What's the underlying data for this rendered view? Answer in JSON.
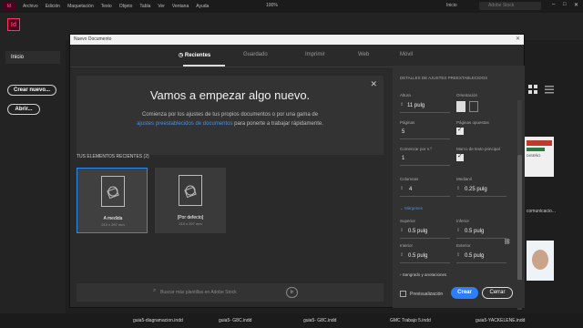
{
  "menubar": {
    "app_icon": "Id",
    "items": [
      "Archivo",
      "Edición",
      "Maquetación",
      "Texto",
      "Objeto",
      "Tabla",
      "Ver",
      "Ventana",
      "Ayuda"
    ],
    "zoom": "100%",
    "inicio": "Inicio",
    "search_placeholder": "Adobe Stock"
  },
  "app_logo": "Id",
  "sidebar": {
    "inicio": "Inicio",
    "crear_nuevo": "Crear nuevo...",
    "abrir": "Abrir..."
  },
  "background": {
    "label_1": "comunicacio...",
    "label_2": "DISEÑO"
  },
  "filestrip": {
    "files": [
      "guia5-diagramacion.indd",
      "guia5- G8C.indd",
      "guia5- G8C.indd",
      "GMC Trabajo 5.indd",
      "guia5-YACKELENE.indd"
    ]
  },
  "dialog": {
    "title": "Nuevo Documento",
    "tabs": [
      "Recientes",
      "Guardado",
      "Imprimir",
      "Web",
      "Móvil"
    ],
    "active_tab": "Recientes",
    "hero": {
      "title": "Vamos a empezar algo nuevo.",
      "line1": "Comienza por los ajustes de tus propios documentos o por una gama de",
      "link": "ajustes preestablecidos de documentos",
      "line2_rest": " para ponerte a trabajar rápidamente."
    },
    "recent_header": "TUS ELEMENTOS RECIENTES  (2)",
    "recent_items": [
      {
        "name": "A medida",
        "dims": "210 x 297 mm"
      },
      {
        "name": "[Por defecto]",
        "dims": "210 x 297 mm"
      }
    ],
    "stock_search_placeholder": "Buscar más plantillas en Adobe Stock",
    "stock_go": "Ir",
    "panel": {
      "header": "DETALLES DE AJUSTES PREESTABLECIDOS",
      "alto_label": "Altura",
      "alto_value": "11 pulg",
      "orientacion_label": "Orientación",
      "paginas_label": "Páginas",
      "paginas_value": "5",
      "paginas_opuestas_label": "Páginas opuestas",
      "comenzar_label": "Comenzar por n.º",
      "comenzar_value": "1",
      "marco_label": "Marco de texto principal",
      "columnas_label": "Columnas",
      "columnas_value": "4",
      "medianil_label": "Medianil",
      "medianil_value": "0.25 pulg",
      "margenes_label": "Márgenes",
      "superior_label": "Superior",
      "superior_value": "0.5 pulg",
      "inferior_label": "Inferior",
      "inferior_value": "0.5 pulg",
      "interior_label": "Interior",
      "interior_value": "0.5 pulg",
      "exterior_label": "Exterior",
      "exterior_value": "0.5 pulg",
      "sangrado_label": "Sangrado y anotaciones"
    },
    "footer": {
      "preview_label": "Previsualización",
      "crear": "Crear",
      "cerrar": "Cerrar"
    }
  }
}
